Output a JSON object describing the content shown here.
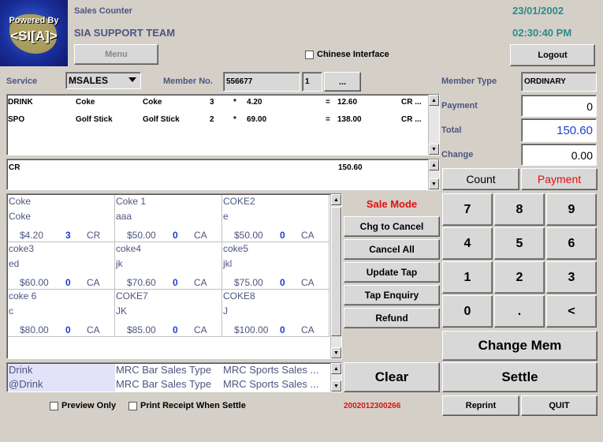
{
  "header": {
    "logo_line1": "Powered By",
    "logo_line2": "<SI[A]>",
    "app_title": "Sales Counter",
    "team": "SIA SUPPORT TEAM",
    "date": "23/01/2002",
    "time": "02:30:40 PM",
    "menu_label": "Menu",
    "chinese_label": "Chinese Interface",
    "logout_label": "Logout"
  },
  "form": {
    "service_label": "Service",
    "service_value": "MSALES",
    "member_label": "Member No.",
    "member_value": "556677",
    "member_seq": "1",
    "ellipsis": "...",
    "member_type_label": "Member Type",
    "member_type_value": "ORDINARY"
  },
  "lines": [
    {
      "cat": "DRINK",
      "item": "Coke",
      "desc": "Coke",
      "qty": "3",
      "x": "*",
      "price": "4.20",
      "eq": "=",
      "amount": "12.60",
      "type": "CR ..."
    },
    {
      "cat": "SPO",
      "item": "Golf Stick",
      "desc": "Golf Stick",
      "qty": "2",
      "x": "*",
      "price": "69.00",
      "eq": "=",
      "amount": "138.00",
      "type": "CR ..."
    }
  ],
  "summary_line": {
    "type": "CR",
    "amount": "150.60"
  },
  "totals": {
    "payment_label": "Payment",
    "payment_value": "0",
    "total_label": "Total",
    "total_value": "150.60",
    "change_label": "Change",
    "change_value": "0.00"
  },
  "tabs": {
    "count": "Count",
    "payment": "Payment"
  },
  "products": [
    {
      "name": "Coke",
      "desc": "Coke",
      "price": "$4.20",
      "qty": "3",
      "type": "CR"
    },
    {
      "name": "Coke 1",
      "desc": "aaa",
      "price": "$50.00",
      "qty": "0",
      "type": "CA"
    },
    {
      "name": "COKE2",
      "desc": "e",
      "price": "$50.00",
      "qty": "0",
      "type": "CA"
    },
    {
      "name": "coke3",
      "desc": "ed",
      "price": "$60.00",
      "qty": "0",
      "type": "CA"
    },
    {
      "name": "coke4",
      "desc": "jk",
      "price": "$70.60",
      "qty": "0",
      "type": "CA"
    },
    {
      "name": "coke5",
      "desc": "jkl",
      "price": "$75.00",
      "qty": "0",
      "type": "CA"
    },
    {
      "name": "coke 6",
      "desc": "c",
      "price": "$80.00",
      "qty": "0",
      "type": "CA"
    },
    {
      "name": "COKE7",
      "desc": "JK",
      "price": "$85.00",
      "qty": "0",
      "type": "CA"
    },
    {
      "name": "COKE8",
      "desc": "J",
      "price": "$100.00",
      "qty": "0",
      "type": "CA"
    }
  ],
  "actions": {
    "sale_mode": "Sale Mode",
    "chg_cancel": "Chg to Cancel",
    "cancel_all": "Cancel All",
    "update_tap": "Update Tap",
    "tap_enquiry": "Tap Enquiry",
    "refund": "Refund",
    "clear": "Clear"
  },
  "keypad": [
    "7",
    "8",
    "9",
    "4",
    "5",
    "6",
    "1",
    "2",
    "3",
    "0",
    ".",
    "<"
  ],
  "big_buttons": {
    "change_mem": "Change Mem",
    "settle": "Settle",
    "reprint": "Reprint",
    "quit": "QUIT"
  },
  "categories": [
    {
      "a": "Drink",
      "b": "MRC Bar Sales Type",
      "c": "MRC Sports Sales ..."
    },
    {
      "a": "@Drink",
      "b": "MRC Bar Sales Type",
      "c": "MRC Sports Sales ..."
    }
  ],
  "footer": {
    "preview_label": "Preview Only",
    "print_label": "Print Receipt When Settle",
    "receipt_no": "2002012300266"
  },
  "colors": {
    "accent_red": "#e01010",
    "value_blue": "#1e3cd2",
    "label": "#4d5580",
    "teal": "#2b8a8a"
  }
}
